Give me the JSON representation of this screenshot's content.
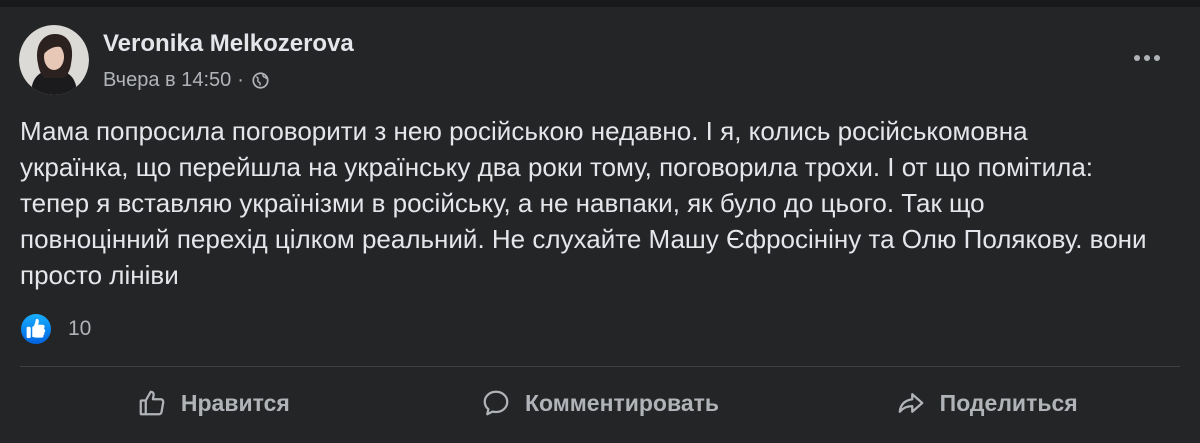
{
  "post": {
    "author": "Veronika Melkozerova",
    "timestamp": "Вчера в 14:50",
    "separator": "·",
    "audience_icon": "globe-icon",
    "more_icon": "more-options-icon",
    "text_lines": [
      "Мама попросила поговорити з нею російською недавно. І я, колись російськомовна",
      "українка, що перейшла на українську два роки тому, поговорила трохи. І от що помітила:",
      "тепер я вставляю українізми в російську, а не навпаки, як було до цього. Так що",
      "повноцінний перехід цілком реальний. Не слухайте Машу Єфросініну та Олю Полякову. вони",
      "просто лініви"
    ],
    "reactions": {
      "icon": "like-reaction-icon",
      "count": "10"
    }
  },
  "actions": [
    {
      "label": "Нравится",
      "icon": "thumbs-up-icon"
    },
    {
      "label": "Комментировать",
      "icon": "comment-icon"
    },
    {
      "label": "Поделиться",
      "icon": "share-icon"
    }
  ],
  "colors": {
    "page_background": "#18191a",
    "card_background": "#242526",
    "primary_text": "#e4e6eb",
    "secondary_text": "#b0b3b8",
    "divider": "#3e4042",
    "like_blue": "#1877f2"
  }
}
